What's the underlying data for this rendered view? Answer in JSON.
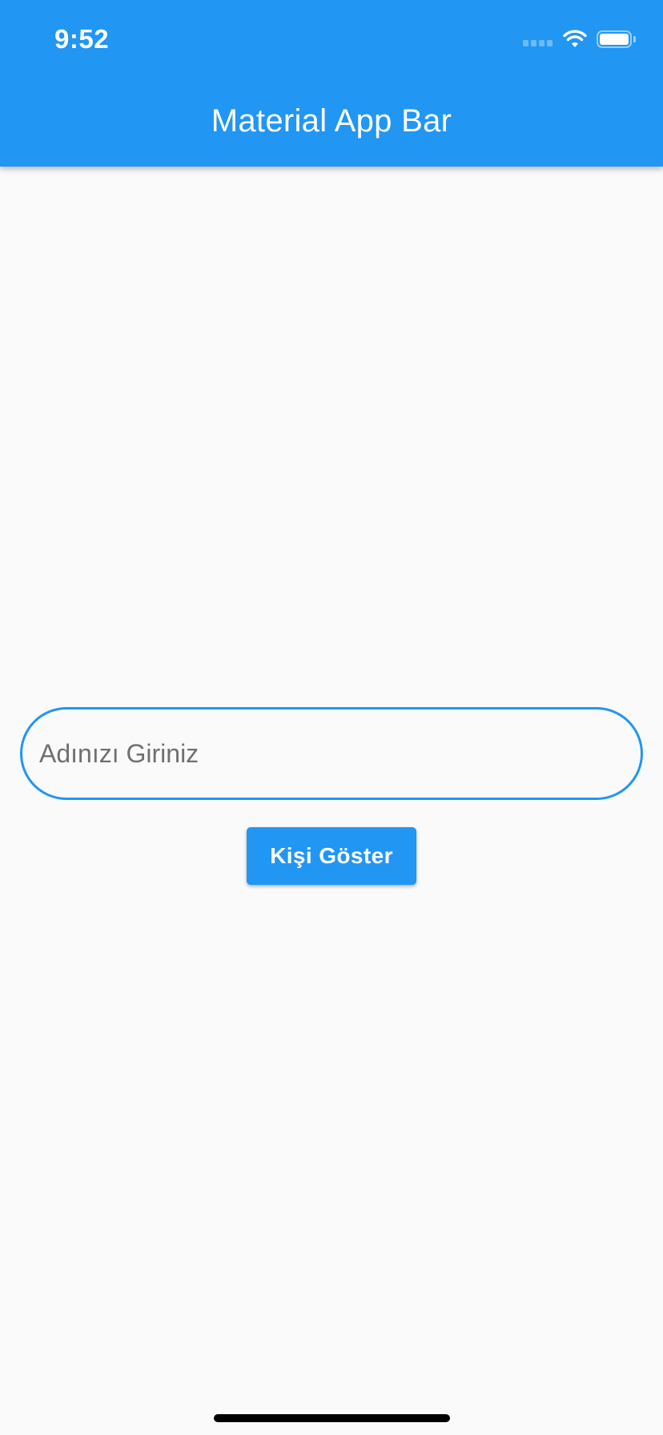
{
  "status_bar": {
    "time": "9:52",
    "icons": [
      "cellular-signal-icon",
      "wifi-icon",
      "battery-icon"
    ]
  },
  "app_bar": {
    "title": "Material App Bar"
  },
  "form": {
    "name_placeholder": "Adınızı Giriniz",
    "name_value": "",
    "button_label": "Kişi Göster"
  },
  "colors": {
    "primary": "#2196f3",
    "background": "#fafafa",
    "placeholder": "#707070"
  }
}
